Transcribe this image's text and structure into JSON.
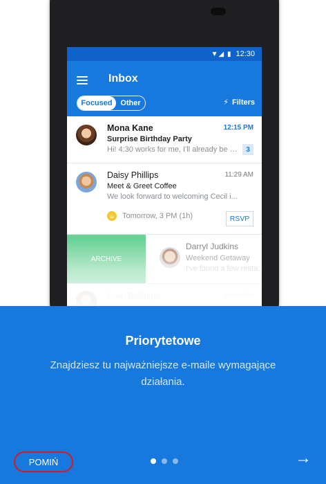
{
  "status": {
    "icons": "▼◢ ▮",
    "time": "12:30"
  },
  "header": {
    "title": "Inbox",
    "tabs": [
      {
        "label": "Focused"
      },
      {
        "label": "Other"
      }
    ],
    "filters_label": "Filters",
    "filter_icon": "bolt-icon"
  },
  "emails": [
    {
      "sender": "Mona Kane",
      "time": "12:15 PM",
      "subject": "Surprise Birthday Party",
      "preview": "Hi! 4:30 works for me, I'll already be in...",
      "count": "3"
    },
    {
      "sender": "Daisy Phillips",
      "time": "11:29 AM",
      "subject": "Meet & Greet Coffee",
      "preview": "We look forward to welcoming Cecil i...",
      "event": "Tomorrow, 3 PM (1h)",
      "rsvp": "RSVP"
    }
  ],
  "swipe_row": {
    "archive_label": "ARCHIVE",
    "sender": "Darryl Judkins",
    "subject": "Weekend Getaway",
    "preview": "I've found a few restaurants..."
  },
  "fade_row": {
    "sender": "Colin Ballinger",
    "time": "Yesterday"
  },
  "onboarding": {
    "title": "Priorytetowe",
    "text": "Znajdziesz tu najważniejsze e-maile wymagające działania.",
    "skip_label": "POMIŃ",
    "next_icon": "arrow-right-icon",
    "page_count": 3,
    "current_page": 1
  },
  "colors": {
    "accent": "#1778de",
    "archive_green": "#6bd296",
    "highlight_red": "#d71920"
  }
}
